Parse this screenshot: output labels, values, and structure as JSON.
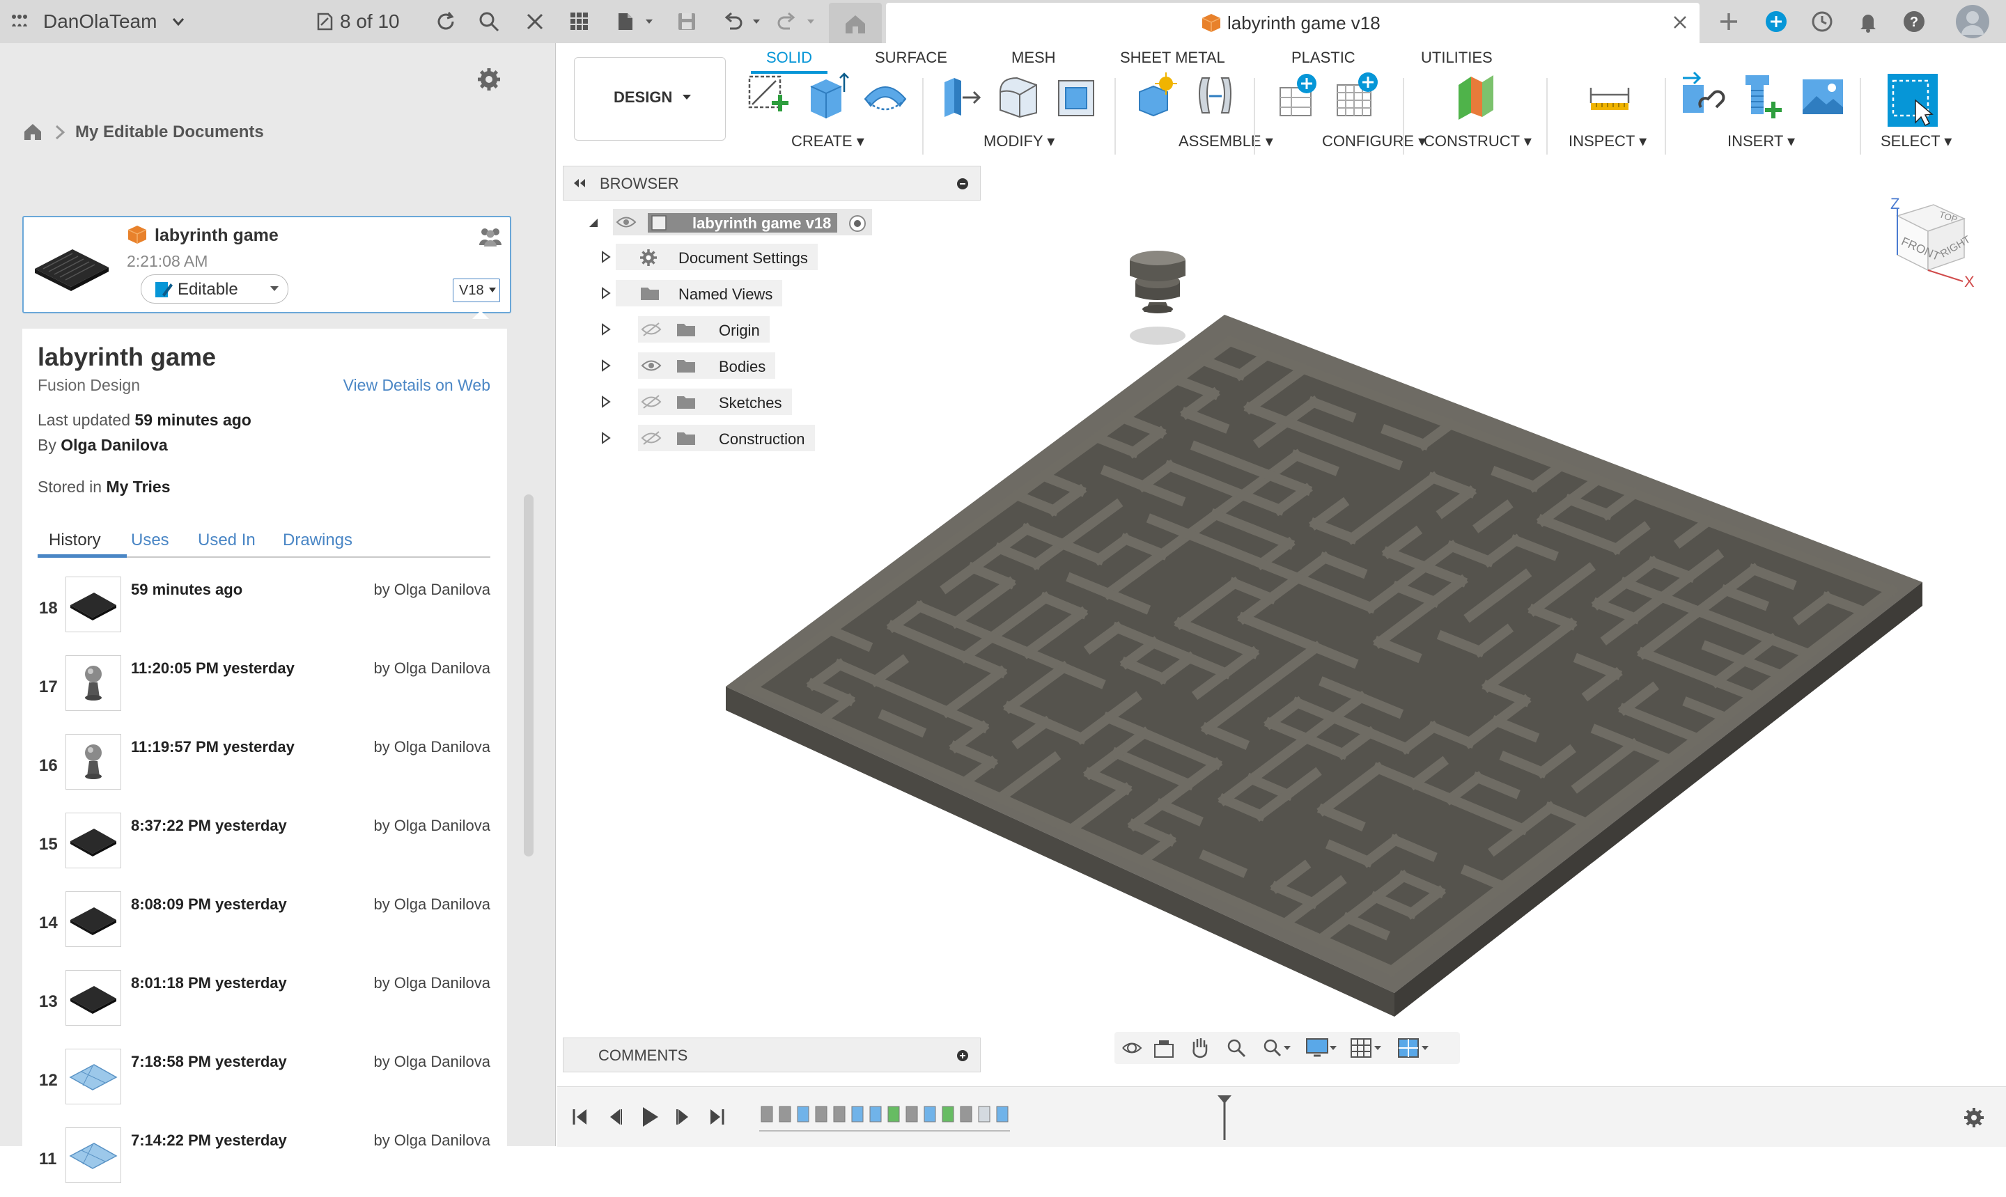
{
  "topbar": {
    "team_name": "DanOlaTeam",
    "jobs_status": "8 of 10",
    "icons": [
      "apps-grid-icon",
      "chevron-down-icon",
      "jobs-icon",
      "refresh-icon",
      "search-icon",
      "close-icon",
      "apps-icon",
      "file-icon",
      "save-icon",
      "undo-icon",
      "redo-icon",
      "home-icon",
      "new-tab-icon",
      "extensions-icon",
      "job-status-icon",
      "notifications-icon",
      "help-icon",
      "profile-avatar"
    ]
  },
  "document_tab": {
    "title": "labyrinth game v18"
  },
  "data_panel": {
    "breadcrumb": "My Editable Documents",
    "card": {
      "name": "labyrinth game",
      "time": "2:21:08 AM",
      "status": "Editable",
      "version": "V18"
    },
    "details": {
      "title": "labyrinth game",
      "type": "Fusion Design",
      "view_link": "View Details on Web",
      "updated_prefix": "Last updated",
      "updated_value": "59 minutes ago",
      "by_prefix": "By",
      "by_value": "Olga Danilova",
      "stored_prefix": "Stored in",
      "stored_value": "My Tries"
    },
    "tabs": [
      "History",
      "Uses",
      "Used In",
      "Drawings"
    ],
    "history": [
      {
        "num": "18",
        "time": "59 minutes ago",
        "by": "by Olga Danilova",
        "thumb": "maze"
      },
      {
        "num": "17",
        "time": "11:20:05 PM yesterday",
        "by": "by Olga Danilova",
        "thumb": "knob"
      },
      {
        "num": "16",
        "time": "11:19:57 PM yesterday",
        "by": "by Olga Danilova",
        "thumb": "knob"
      },
      {
        "num": "15",
        "time": "8:37:22 PM yesterday",
        "by": "by Olga Danilova",
        "thumb": "maze"
      },
      {
        "num": "14",
        "time": "8:08:09 PM yesterday",
        "by": "by Olga Danilova",
        "thumb": "maze"
      },
      {
        "num": "13",
        "time": "8:01:18 PM yesterday",
        "by": "by Olga Danilova",
        "thumb": "maze"
      },
      {
        "num": "12",
        "time": "7:18:58 PM yesterday",
        "by": "by Olga Danilova",
        "thumb": "plane"
      },
      {
        "num": "11",
        "time": "7:14:22 PM yesterday",
        "by": "by Olga Danilova",
        "thumb": "plane"
      }
    ]
  },
  "toolbar": {
    "workspace": "DESIGN",
    "tabs": [
      "SOLID",
      "SURFACE",
      "MESH",
      "SHEET METAL",
      "PLASTIC",
      "UTILITIES"
    ],
    "active_tab": "SOLID",
    "groups": [
      "CREATE",
      "MODIFY",
      "ASSEMBLE",
      "CONFIGURE",
      "CONSTRUCT",
      "INSPECT",
      "INSERT",
      "SELECT"
    ]
  },
  "browser": {
    "title": "BROWSER",
    "root": "labyrinth game v18",
    "items": [
      {
        "label": "Document Settings",
        "icon": "gear-icon",
        "visibility": "none"
      },
      {
        "label": "Named Views",
        "icon": "folder-icon",
        "visibility": "none"
      },
      {
        "label": "Origin",
        "icon": "folder-icon",
        "visibility": "hidden"
      },
      {
        "label": "Bodies",
        "icon": "folder-icon",
        "visibility": "visible"
      },
      {
        "label": "Sketches",
        "icon": "folder-icon",
        "visibility": "hidden"
      },
      {
        "label": "Construction",
        "icon": "folder-icon",
        "visibility": "hidden"
      }
    ]
  },
  "viewcube": {
    "top": "TOP",
    "front": "FRONT",
    "right": "RIGHT",
    "z_axis": "Z",
    "x_axis": "X"
  },
  "comments": {
    "title": "COMMENTS"
  },
  "colors": {
    "accent": "#0696d7",
    "model_body": "#5f5c55",
    "model_top": "#6f6c64",
    "panel_bg": "#e9e9e9"
  }
}
